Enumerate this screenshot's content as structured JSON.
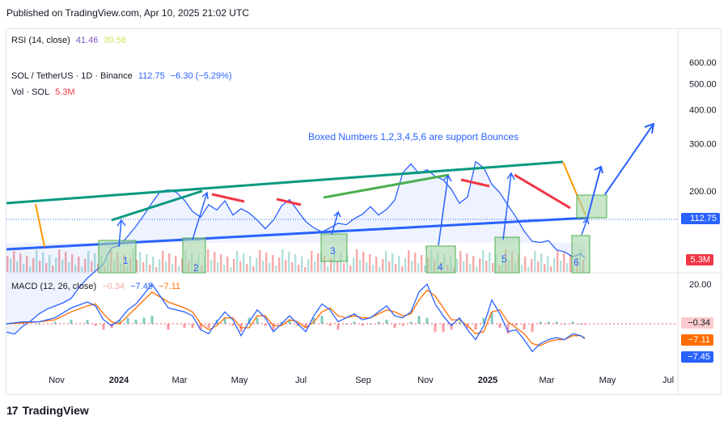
{
  "header": {
    "published": "Published on TradingView.com, Apr 10, 2025 21:02 UTC"
  },
  "rsi_legend": {
    "label": "RSI (14, close)",
    "value1": "41.46",
    "value2": "39.56"
  },
  "symbol_legend": {
    "label": "SOL / TetherUS · 1D · Binance",
    "price": "112.75",
    "change": "−6.30 (−5.29%)"
  },
  "vol_legend": {
    "label": "Vol · SOL",
    "value": "5.3M"
  },
  "macd_legend": {
    "label": "MACD (12, 26, close)",
    "hist": "−0.34",
    "macd": "−7.45",
    "signal": "−7.11"
  },
  "annotation": "Boxed Numbers 1,2,3,4,5,6 are support Bounces",
  "footer": {
    "brand": "TradingView"
  },
  "colors": {
    "price_line": "#2962ff",
    "resistance": "#089981",
    "support": "#2962ff",
    "fib_down": "#f23645",
    "up_leg": "#4caf50",
    "orange": "#ff9800",
    "box_fill": "#a5d6a7",
    "macd_line": "#2962ff",
    "signal_line": "#ff6d00",
    "volume": "#b2b5be"
  },
  "chart_data": [
    {
      "type": "line",
      "title": "SOL / TetherUS · 1D · Binance",
      "x_tick_labels": [
        "Nov",
        "2024",
        "Mar",
        "May",
        "Jul",
        "Sep",
        "Nov",
        "2025",
        "Mar",
        "May",
        "Jul"
      ],
      "y_axis_labels": [
        "600.00",
        "500.00",
        "400.00",
        "300.00",
        "200.00",
        "112.75"
      ],
      "y_scale": "log",
      "ylim": [
        48,
        620
      ],
      "last_price": 112.75,
      "series": [
        {
          "x": [
            0,
            10,
            20,
            30,
            40,
            50,
            60,
            70,
            80,
            90,
            100,
            110,
            120,
            125,
            130,
            140,
            150,
            160,
            170,
            180,
            190,
            200,
            210,
            220,
            230,
            240,
            250,
            260,
            270,
            280,
            290,
            300,
            310,
            320,
            330,
            340,
            350,
            360,
            370,
            380,
            390,
            400,
            410,
            420,
            430,
            440,
            450,
            460,
            470,
            480,
            490,
            500,
            510,
            520,
            530,
            540,
            550,
            560,
            570,
            580,
            590,
            600,
            610,
            620,
            630,
            640,
            650,
            660,
            670,
            680,
            690,
            700,
            710,
            715
          ],
          "values": [
            60,
            59,
            63,
            66,
            70,
            73,
            75,
            77,
            80,
            88,
            95,
            101,
            107,
            116,
            123,
            126,
            136,
            148,
            163,
            181,
            199,
            202,
            198,
            185,
            168,
            160,
            178,
            170,
            184,
            163,
            172,
            166,
            156,
            145,
            156,
            176,
            186,
            169,
            154,
            146,
            141,
            146,
            152,
            150,
            158,
            164,
            175,
            163,
            171,
            185,
            234,
            252,
            232,
            240,
            227,
            220,
            203,
            180,
            190,
            257,
            244,
            212,
            197,
            177,
            160,
            142,
            130,
            129,
            131,
            121,
            119,
            114,
            117,
            112.75
          ]
        }
      ],
      "boxes": [
        "1",
        "2",
        "3",
        "4",
        "5",
        "6"
      ],
      "annotation": "Boxed Numbers 1,2,3,4,5,6 are support Bounces"
    },
    {
      "type": "line",
      "title": "MACD (12, 26, close)",
      "y_axis_labels": [
        "20.00"
      ],
      "ylim": [
        -16,
        24
      ],
      "x": [
        0,
        20,
        40,
        60,
        80,
        100,
        110,
        120,
        130,
        140,
        150,
        160,
        170,
        180,
        200,
        220,
        230,
        240,
        250,
        260,
        270,
        280,
        290,
        300,
        310,
        320,
        330,
        340,
        350,
        360,
        370,
        380,
        390,
        400,
        410,
        420,
        430,
        440,
        450,
        460,
        470,
        480,
        490,
        500,
        510,
        520,
        530,
        540,
        550,
        560,
        570,
        580,
        590,
        600,
        610,
        620,
        630,
        640,
        650,
        660,
        670,
        680,
        690,
        700,
        710,
        715
      ],
      "series": [
        {
          "name": "MACD",
          "values": [
            0,
            1,
            1,
            3,
            8,
            11,
            9,
            2,
            -1,
            2,
            7,
            10,
            15,
            20,
            8,
            6,
            4,
            -3,
            -5,
            1,
            6,
            2,
            -6,
            1,
            7,
            3,
            -4,
            0,
            4,
            0,
            -4,
            4,
            10,
            7,
            1,
            3,
            5,
            2,
            3,
            6,
            9,
            4,
            3,
            6,
            16,
            20,
            10,
            4,
            -1,
            3,
            -3,
            -8,
            -1,
            12,
            5,
            -4,
            -3,
            -8,
            -14,
            -10,
            -8,
            -7,
            -8,
            -5,
            -6,
            -7.45
          ]
        },
        {
          "name": "Signal",
          "values": [
            0,
            0.5,
            1,
            2,
            6,
            9,
            10,
            5,
            1,
            0,
            4,
            8,
            12,
            16,
            11,
            8,
            6,
            0,
            -3,
            -1,
            3,
            3,
            -2,
            -2,
            4,
            4,
            -1,
            -1,
            2,
            1,
            -2,
            1,
            6,
            8,
            4,
            3,
            4,
            3,
            3,
            5,
            7,
            6,
            4,
            5,
            12,
            17,
            14,
            8,
            2,
            2,
            -1,
            -5,
            -4,
            6,
            7,
            1,
            -2,
            -5,
            -10,
            -11,
            -9,
            -8,
            -8,
            -6,
            -6,
            -7.11
          ]
        }
      ]
    }
  ]
}
